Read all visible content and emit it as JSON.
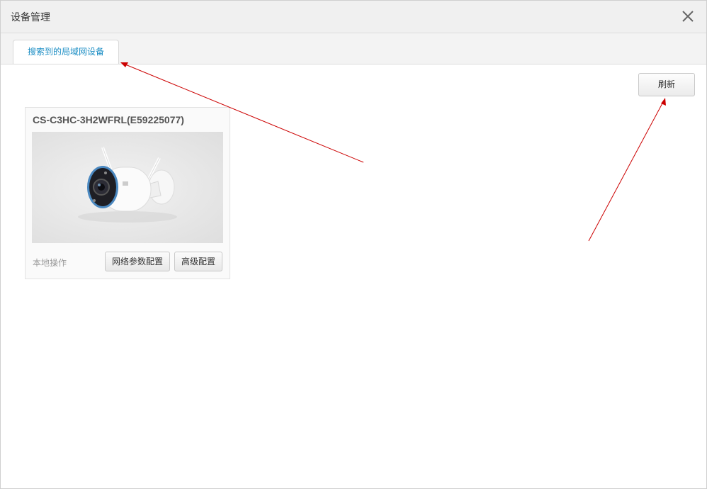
{
  "window": {
    "title": "设备管理"
  },
  "tabs": [
    {
      "label": "搜索到的局域网设备",
      "active": true
    }
  ],
  "toolbar": {
    "refresh_label": "刷新"
  },
  "devices": [
    {
      "name": "CS-C3HC-3H2WFRL(E59225077)",
      "local_label": "本地操作",
      "network_button": "网络参数配置",
      "advanced_button": "高级配置"
    }
  ],
  "colors": {
    "accent": "#1a8dc4",
    "annotation": "#cc0000"
  },
  "icons": {
    "close": "close-icon",
    "camera": "camera-image"
  }
}
